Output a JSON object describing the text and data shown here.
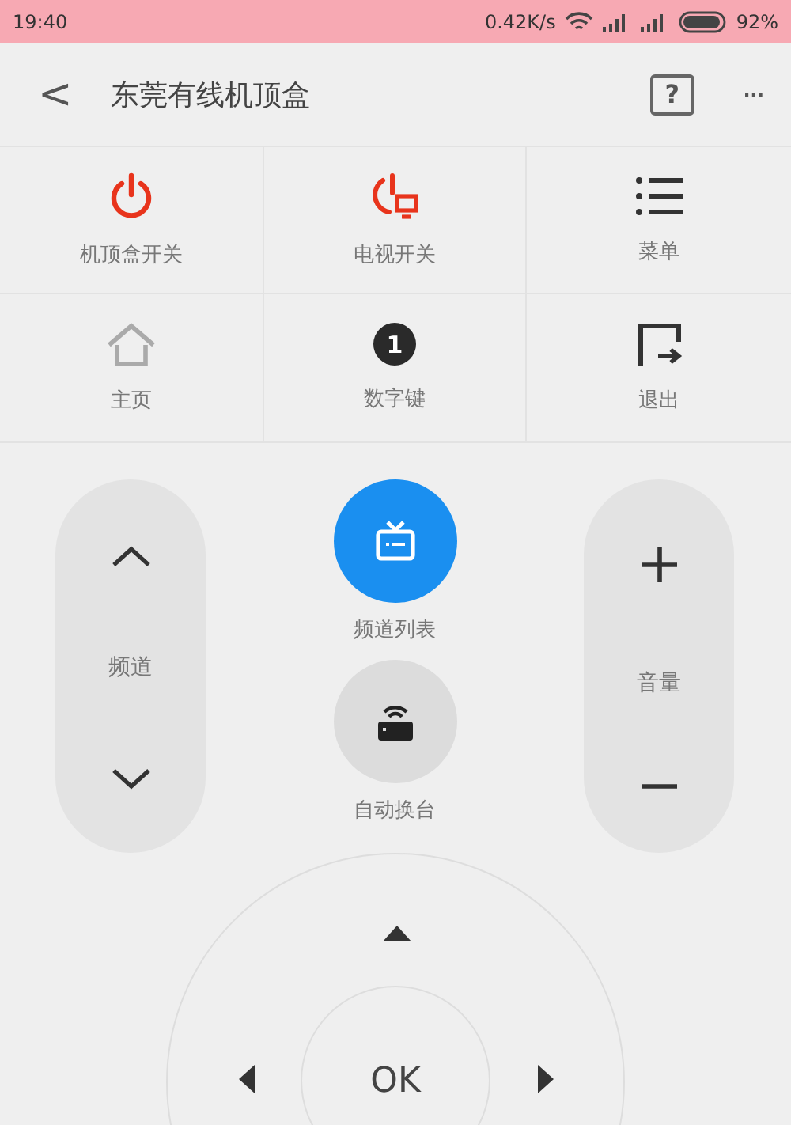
{
  "status_bar": {
    "time": "19:40",
    "speed": "0.42K/s",
    "battery": "92%"
  },
  "header": {
    "back": "<",
    "title": "东莞有线机顶盒",
    "help": "?",
    "more": "···"
  },
  "grid": [
    {
      "kind": "power",
      "label": "机顶盒开关"
    },
    {
      "kind": "tv-power",
      "label": "电视开关"
    },
    {
      "kind": "menu",
      "label": "菜单"
    },
    {
      "kind": "home",
      "label": "主页"
    },
    {
      "kind": "number",
      "label": "数字键",
      "glyph": "1"
    },
    {
      "kind": "exit",
      "label": "退出"
    }
  ],
  "channel": {
    "label": "频道"
  },
  "volume": {
    "label": "音量"
  },
  "center": [
    {
      "kind": "tv-list",
      "label": "频道列表"
    },
    {
      "kind": "auto",
      "label": "自动换台"
    }
  ],
  "dpad": {
    "ok": "OK"
  }
}
